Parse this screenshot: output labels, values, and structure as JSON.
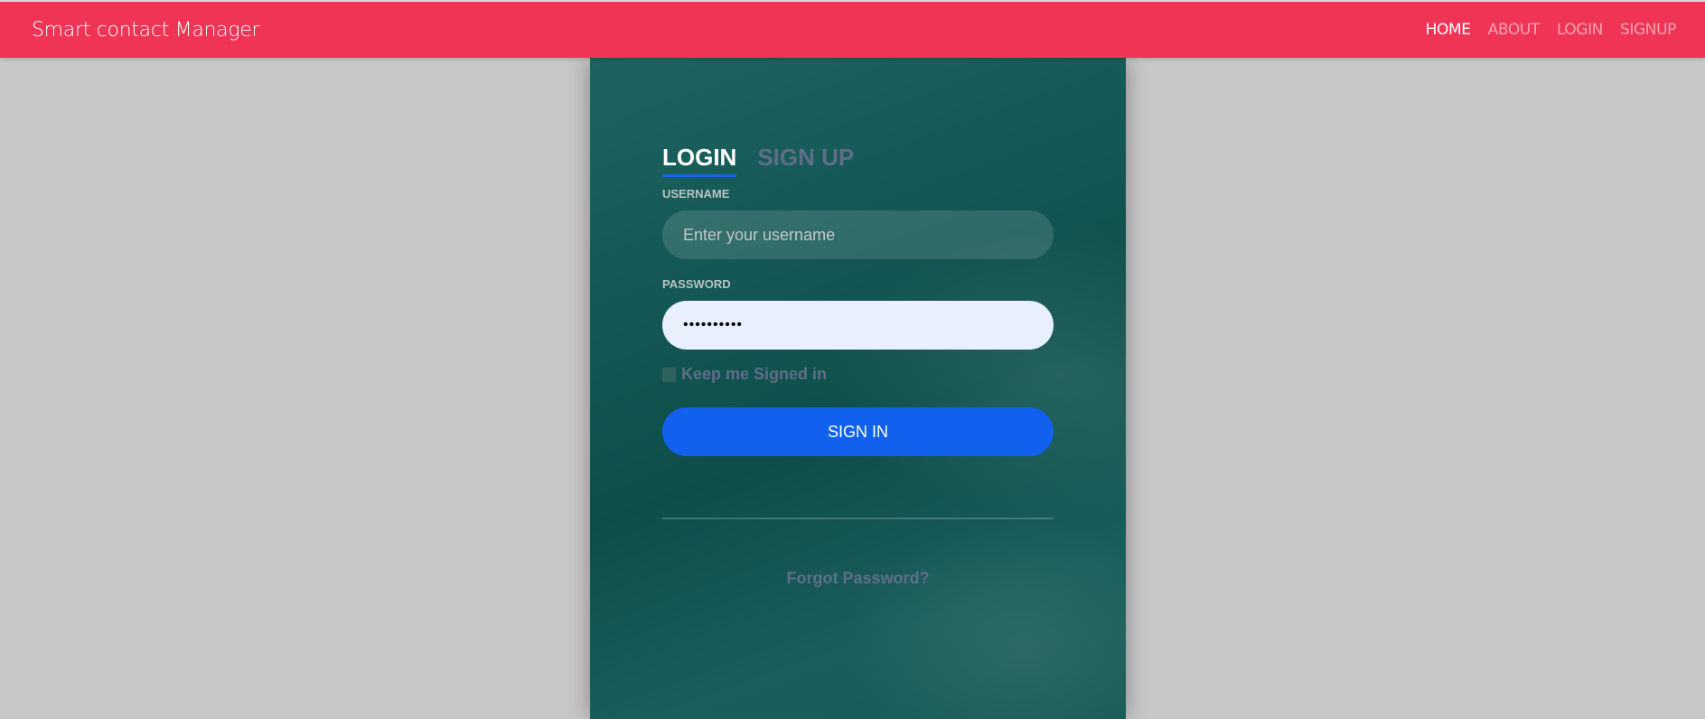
{
  "navbar": {
    "brand": "Smart contact Manager",
    "links": [
      "HOME",
      "ABOUT",
      "LOGIN",
      "SIGNUP"
    ],
    "active": "HOME",
    "color": "#f03456"
  },
  "form": {
    "tabs": [
      "LOGIN",
      "SIGN UP"
    ],
    "active_tab": "LOGIN",
    "username_label": "USERNAME",
    "username_placeholder": "Enter your username",
    "username_value": "",
    "password_label": "PASSWORD",
    "password_value": "••••••••••",
    "keep_signed_in": "Keep me Signed in",
    "keep_signed_in_checked": false,
    "sign_in": "SIGN IN",
    "forgot": "Forgot Password?",
    "accent": "#1161ee"
  }
}
